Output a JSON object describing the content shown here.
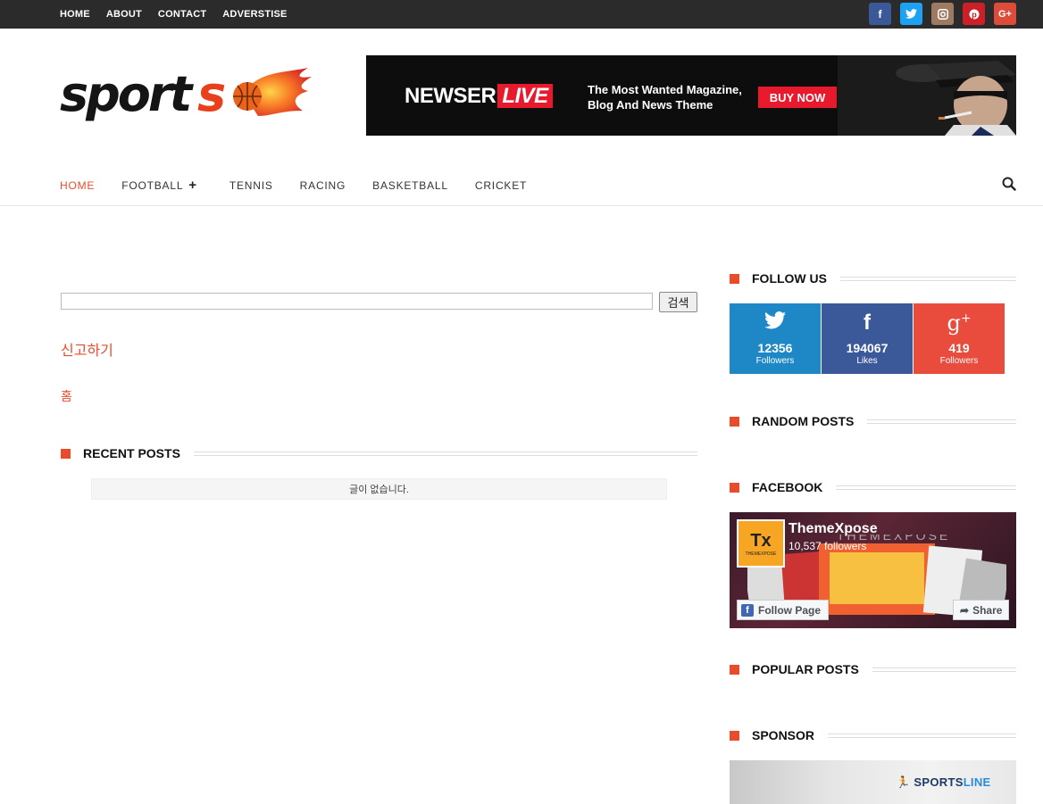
{
  "topnav": [
    "HOME",
    "ABOUT",
    "CONTACT",
    "ADVERSTISE"
  ],
  "social_top": [
    {
      "icon": "facebook-icon",
      "glyph": "f",
      "color": "#3b5998"
    },
    {
      "icon": "twitter-icon",
      "glyph": "t",
      "color": "#1da1f2"
    },
    {
      "icon": "instagram-icon",
      "glyph": "◙",
      "color": "#9e7a62"
    },
    {
      "icon": "pinterest-icon",
      "glyph": "P",
      "color": "#cb2027"
    },
    {
      "icon": "google-plus-icon",
      "glyph": "G+",
      "color": "#dd4b39"
    }
  ],
  "logo": {
    "text": "sports"
  },
  "banner": {
    "brand": "NEWSER",
    "live": "LIVE",
    "tagline1": "The Most Wanted Magazine,",
    "tagline2": "Blog And News Theme",
    "buy": "BUY NOW"
  },
  "mainnav": {
    "items": [
      "HOME",
      "FOOTBALL",
      "TENNIS",
      "RACING",
      "BASKETBALL",
      "CRICKET"
    ],
    "active": "HOME"
  },
  "search": {
    "button": "검색",
    "value": ""
  },
  "report_link": "신고하기",
  "home_link": "홈",
  "recent_posts": {
    "title": "RECENT POSTS",
    "empty": "글이 없습니다."
  },
  "sidebar": {
    "follow_title": "FOLLOW US",
    "follow": [
      {
        "icon": "twitter-icon",
        "glyph": "🐦",
        "count": "12356",
        "label": "Followers",
        "color": "#1e88c7"
      },
      {
        "icon": "facebook-icon",
        "glyph": "f",
        "count": "194067",
        "label": "Likes",
        "color": "#3b5998"
      },
      {
        "icon": "google-plus-icon",
        "glyph": "g+",
        "count": "419",
        "label": "Followers",
        "color": "#e94b3c"
      }
    ],
    "random_title": "RANDOM POSTS",
    "facebook_title": "FACEBOOK",
    "fb": {
      "name": "ThemeXpose",
      "followers": "10,537 followers",
      "follow_btn": "Follow Page",
      "share_btn": "Share",
      "avatar": "Tx",
      "avatar_sub": "THEMEXPOSE"
    },
    "popular_title": "POPULAR POSTS",
    "sponsor_title": "SPONSOR",
    "sponsor": {
      "brand1": "SPORTS",
      "brand2": "LINE"
    }
  },
  "accent": "#e84c2b"
}
